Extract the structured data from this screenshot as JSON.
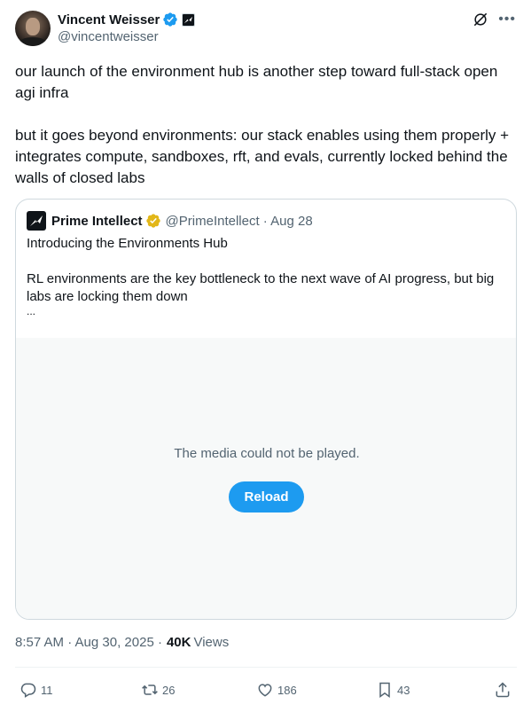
{
  "author": {
    "name": "Vincent Weisser",
    "handle": "@vincentweisser",
    "avatar_icon": "person-avatar"
  },
  "tweet": {
    "paragraphs": [
      "our launch of the environment hub is another step toward full-stack open agi infra",
      "but it goes beyond environments: our stack enables using them properly + integrates compute, sandboxes, rft, and evals, currently locked behind the walls of closed labs"
    ]
  },
  "quote": {
    "name": "Prime Intellect",
    "handle_date": "@PrimeIntellect · Aug 28",
    "line1": "Introducing the Environments Hub",
    "line2": "RL environments are the key bottleneck to the next wave of AI progress, but big labs are locking them down",
    "ellipsis": "...",
    "media_message": "The media could not be played.",
    "reload_label": "Reload"
  },
  "meta": {
    "timestamp": "8:57 AM · Aug 30, 2025 ·",
    "views_count": "40K",
    "views_label": "Views"
  },
  "actions": {
    "replies": "11",
    "reposts": "26",
    "likes": "186",
    "bookmarks": "43"
  },
  "colors": {
    "accent": "#1d9bf0",
    "secondary_text": "#536471",
    "gold_verified": "#e2b719",
    "border": "#cfd9de",
    "media_bg": "#f7f9f9"
  }
}
